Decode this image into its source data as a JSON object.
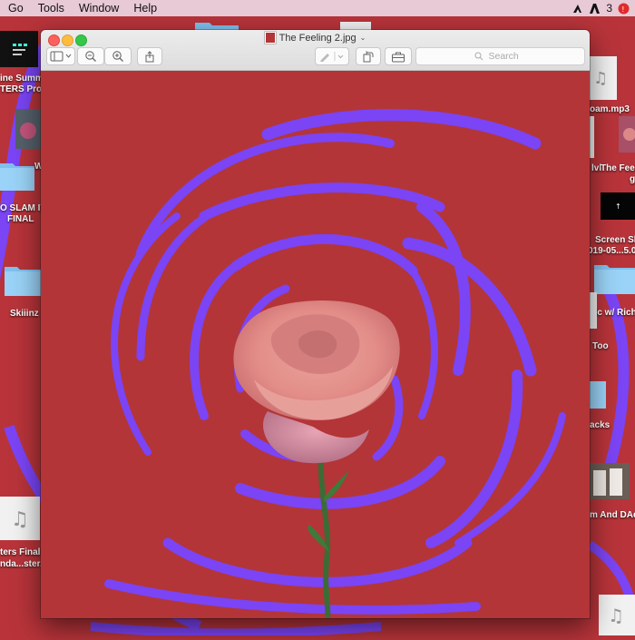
{
  "menubar": {
    "items": [
      "Go",
      "Tools",
      "Window",
      "Help"
    ],
    "badge_count": "3"
  },
  "desktop": {
    "labels": [
      "ine Summ",
      "TERS Pro",
      "W",
      "O SLAM IT",
      "FINAL",
      "Skiiinz",
      "ters Final",
      "nda...ster.",
      "oam.mp3",
      "lvl",
      "The Feel",
      "g",
      "Screen Sh",
      "019-05...5.0",
      "sic w/ Rich",
      "Too",
      "acks",
      "m And DAd"
    ]
  },
  "window": {
    "title": "The Feeling 2.jpg",
    "search_placeholder": "Search"
  },
  "colors": {
    "background_red": "#b33537",
    "swirl_purple": "#7b44f5"
  }
}
